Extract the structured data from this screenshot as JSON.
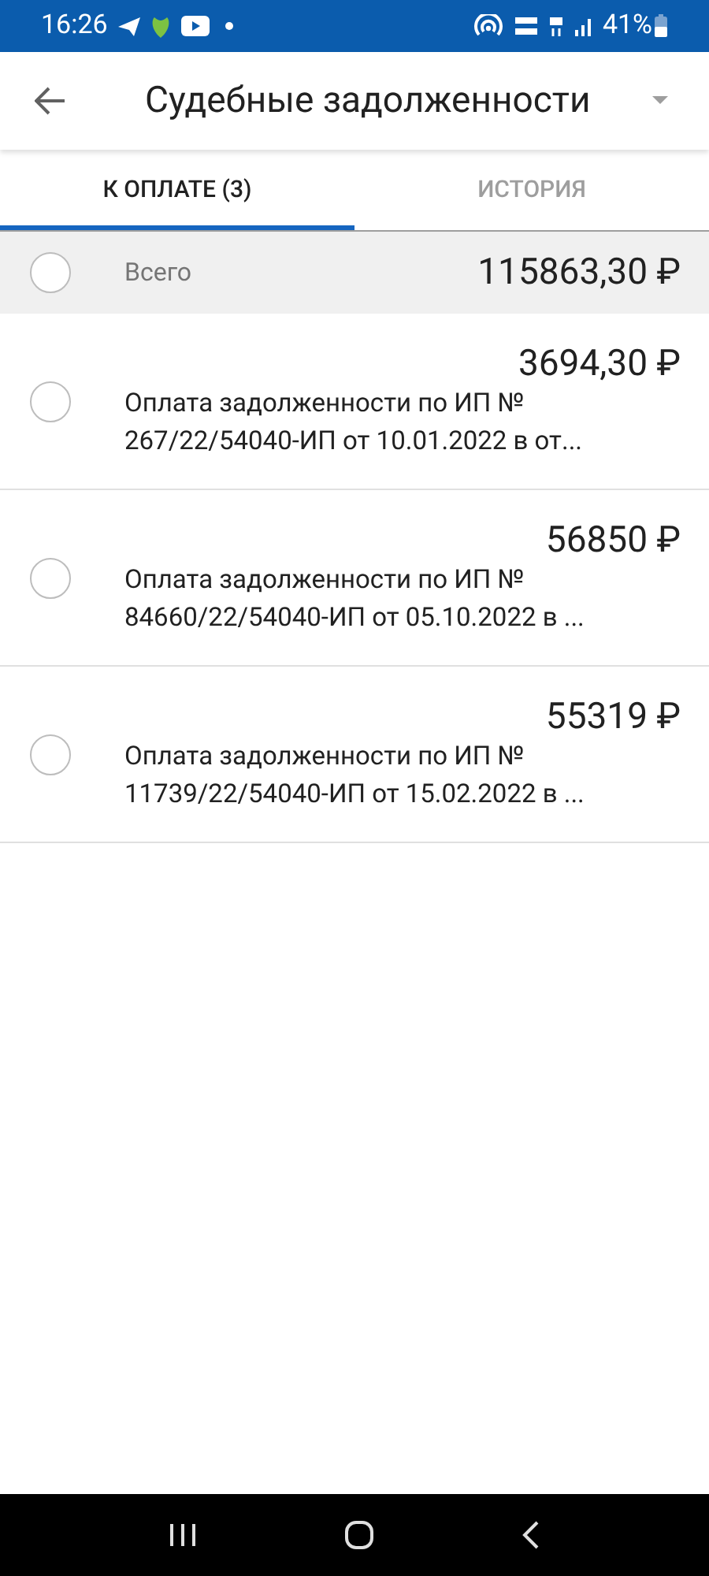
{
  "status_bar": {
    "time": "16:26",
    "battery": "41%"
  },
  "header": {
    "title": "Судебные задолженности"
  },
  "tabs": [
    {
      "label": "К ОПЛАТЕ (3)",
      "selected": true
    },
    {
      "label": "ИСТОРИЯ",
      "selected": false
    }
  ],
  "total": {
    "label": "Всего",
    "amount": "115863,30 ₽",
    "selected": false
  },
  "items": [
    {
      "amount": "3694,30 ₽",
      "description_lines": [
        "Оплата задолженности по ИП №",
        "267/22/54040-ИП от 10.01.2022 в от..."
      ],
      "selected": false
    },
    {
      "amount": "56850 ₽",
      "description_lines": [
        "Оплата задолженности по ИП №",
        "84660/22/54040-ИП от 05.10.2022 в ..."
      ],
      "selected": false
    },
    {
      "amount": "55319 ₽",
      "description_lines": [
        "Оплата задолженности по ИП №",
        "11739/22/54040-ИП от 15.02.2022 в ..."
      ],
      "selected": false
    }
  ]
}
